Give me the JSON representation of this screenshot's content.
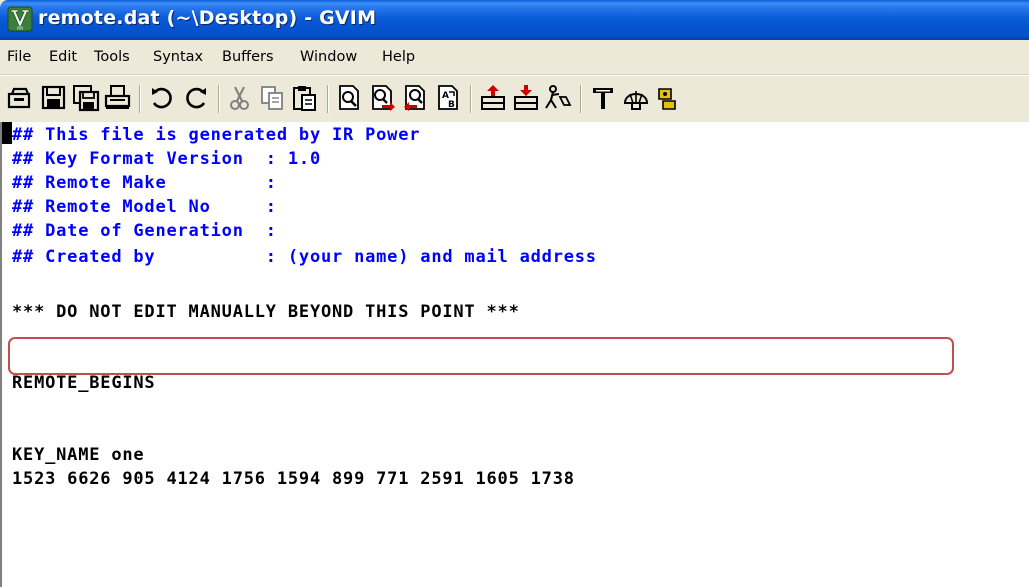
{
  "window": {
    "title": "remote.dat (~\\Desktop) - GVIM",
    "icon": "gvim-app-icon"
  },
  "menu": {
    "items": [
      {
        "label": "File"
      },
      {
        "label": "Edit"
      },
      {
        "label": "Tools"
      },
      {
        "label": "Syntax"
      },
      {
        "label": "Buffers"
      },
      {
        "label": "Window"
      },
      {
        "label": "Help"
      }
    ]
  },
  "toolbar": {
    "buttons": [
      "open-icon",
      "save-icon",
      "save-all-icon",
      "print-icon",
      "undo-icon",
      "redo-icon",
      "cut-icon",
      "copy-icon",
      "paste-icon",
      "find-icon",
      "find-next-icon",
      "find-previous-icon",
      "replace-icon",
      "load-session-icon",
      "save-session-icon",
      "run-script-icon",
      "make-icon",
      "shell-icon",
      "tags-icon"
    ]
  },
  "editor": {
    "lines": [
      {
        "text": "## This file is generated by IR Power",
        "style": "comment"
      },
      {
        "text": "## Key Format Version  : 1.0",
        "style": "comment"
      },
      {
        "text": "## Remote Make         :",
        "style": "comment"
      },
      {
        "text": "## Remote Model No     :",
        "style": "comment"
      },
      {
        "text": "## Date of Generation  :",
        "style": "comment"
      },
      {
        "text": "## Created by          : (your name) and mail address",
        "style": "comment"
      },
      {
        "text": "",
        "style": "normal"
      },
      {
        "text": "*** DO NOT EDIT MANUALLY BEYOND THIS POINT ***",
        "style": "normal"
      },
      {
        "text": "",
        "style": "normal"
      },
      {
        "text": "REMOTE_BEGINS",
        "style": "normal"
      },
      {
        "text": "",
        "style": "normal"
      },
      {
        "text": "KEY_NAME one",
        "style": "normal"
      },
      {
        "text": "1523 6626 905 4124 1756 1594 899 771 2591 1605 1738",
        "style": "normal"
      }
    ]
  },
  "colors": {
    "comment": "#0000ff",
    "text": "#000000",
    "highlight_box": "#c0504d",
    "titlebar": "#0553cf"
  }
}
